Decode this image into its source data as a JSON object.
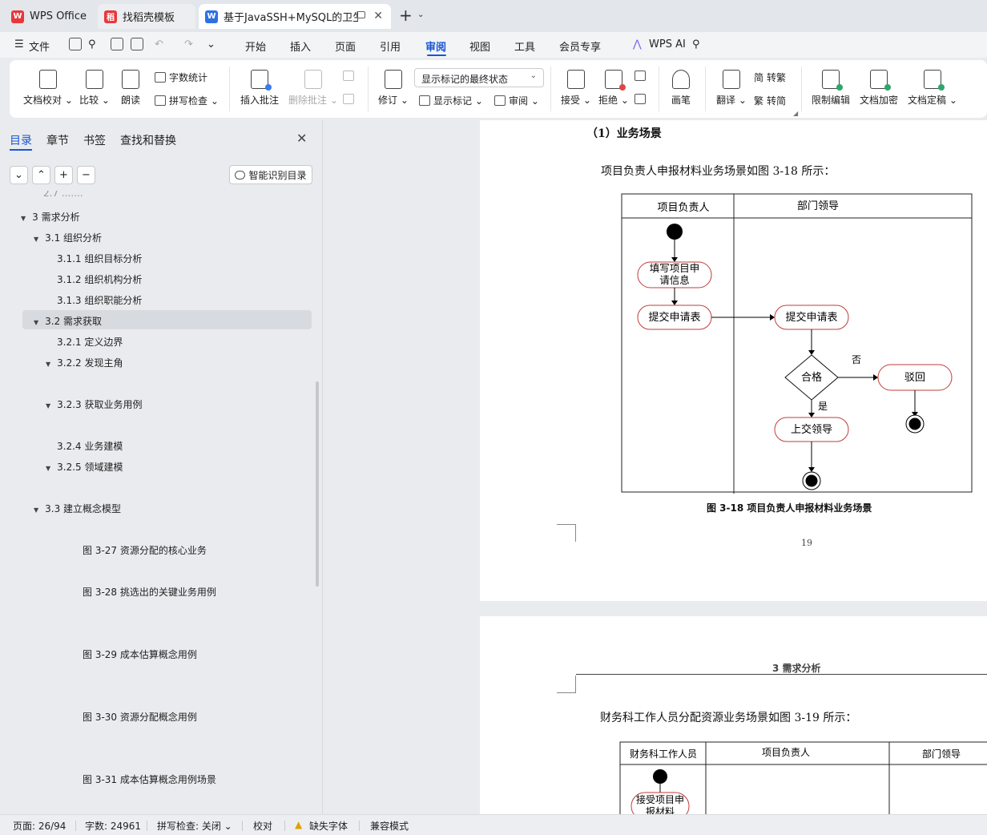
{
  "tabs": [
    {
      "label": "WPS Office",
      "color": "#e8373a"
    },
    {
      "label": "找稻壳模板",
      "color": "#e8373a"
    },
    {
      "label": "基于JavaSSH+MySQL的卫生",
      "color": "#2f6fe4"
    }
  ],
  "menu": {
    "file": "文件",
    "items": [
      "开始",
      "插入",
      "页面",
      "引用",
      "审阅",
      "视图",
      "工具",
      "会员专享"
    ],
    "active": "审阅",
    "wps_ai": "WPS AI"
  },
  "ribbon": {
    "doc_check": "文档校对",
    "compare": "比较",
    "read_aloud": "朗读",
    "word_count": "字数统计",
    "spell_check": "拼写检查",
    "insert_comment": "插入批注",
    "delete_comment": "删除批注",
    "track": "修订",
    "display_state": "显示标记的最终状态",
    "show_markup": "显示标记",
    "review": "审阅",
    "accept": "接受",
    "reject": "拒绝",
    "pen": "画笔",
    "translate": "翻译",
    "to_traditional": "转繁",
    "to_simplified": "转简",
    "restrict_edit": "限制编辑",
    "encrypt": "文档加密",
    "finalize": "文档定稿"
  },
  "left": {
    "tabs": [
      "目录",
      "章节",
      "书签",
      "查找和替换"
    ],
    "active_tab": "目录",
    "smart_button": "智能识别目录",
    "toc": [
      {
        "label": "3  需求分析",
        "expand": true
      },
      {
        "label": "3.1 组织分析",
        "expand": true
      },
      {
        "label": "3.1.1  组织目标分析",
        "expand": false
      },
      {
        "label": "3.1.2 组织机构分析",
        "expand": false
      },
      {
        "label": "3.1.3 组织职能分析",
        "expand": false
      },
      {
        "label": "3.2  需求获取",
        "expand": true
      },
      {
        "label": "3.2.1  定义边界",
        "expand": false
      },
      {
        "label": "3.2.2  发现主角",
        "expand": true
      },
      {
        "label": "3.2.3  获取业务用例",
        "expand": true
      },
      {
        "label": "3.2.4 业务建模",
        "expand": false
      },
      {
        "label": "3.2.5 领域建模",
        "expand": true
      },
      {
        "label": "3.3 建立概念模型",
        "expand": true
      },
      {
        "label": "图 3-27    资源分配的核心业务",
        "expand": false
      },
      {
        "label": "图 3-28     挑选出的关键业务用例",
        "expand": false
      },
      {
        "label": "图 3-29    成本估算概念用例",
        "expand": false
      },
      {
        "label": "图 3-30    资源分配概念用例",
        "expand": false
      },
      {
        "label": "图 3-31    成本估算概念用例场景",
        "expand": false
      }
    ]
  },
  "doc": {
    "section_heading": "（1）业务场景",
    "para1": "项目负责人申报材料业务场景如图 3-18 所示：",
    "diagram1": {
      "lane1": "项目负责人",
      "lane2": "部门领导",
      "node_fill": "填写项目申请信息",
      "node_submit1": "提交申请表",
      "node_submit2": "提交申请表",
      "decision": "合格",
      "no": "否",
      "yes": "是",
      "reject": "驳回",
      "upper": "上交领导"
    },
    "caption1": "图 3-18      项目负责人申报材料业务场景",
    "page_number": "19",
    "header2": "3 需求分析",
    "para2": "财务科工作人员分配资源业务场景如图 3-19 所示：",
    "diagram2": {
      "lane1": "财务科工作人员",
      "lane2": "项目负责人",
      "lane3": "部门领导",
      "node1": "接受项目申报材料"
    }
  },
  "status": {
    "page": "页面: 26/94",
    "words": "字数: 24961",
    "spell": "拼写检查: 关闭",
    "proof": "校对",
    "missing_font": "缺失字体",
    "compat": "兼容模式"
  }
}
